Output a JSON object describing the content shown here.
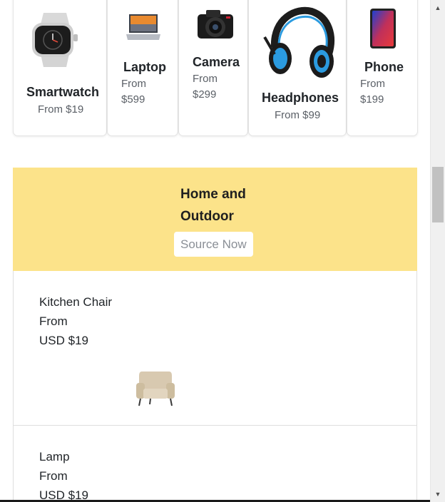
{
  "products": [
    {
      "title": "Smartwatch",
      "price": "From $19",
      "icon": "smartwatch-image"
    },
    {
      "title": "Laptop",
      "price_line1": "From",
      "price_line2": "$599",
      "icon": "laptop-image"
    },
    {
      "title": "Camera",
      "price_line1": "From",
      "price_line2": "$299",
      "icon": "camera-image"
    },
    {
      "title": "Headphones",
      "price": "From $99",
      "icon": "headphones-image"
    },
    {
      "title": "Phone",
      "price_line1": "From",
      "price_line2": "$199",
      "icon": "phone-image"
    }
  ],
  "category": {
    "title_line1": "Home and",
    "title_line2": "Outdoor",
    "button_label": "Source Now",
    "background": "#fce38a"
  },
  "items": [
    {
      "name": "Kitchen Chair",
      "from": "From",
      "price": "USD $19",
      "icon": "armchair-image"
    },
    {
      "name": "Lamp",
      "from": "From",
      "price": "USD $19"
    }
  ],
  "scrollbar": {
    "up_glyph": "▲",
    "down_glyph": "▼"
  }
}
